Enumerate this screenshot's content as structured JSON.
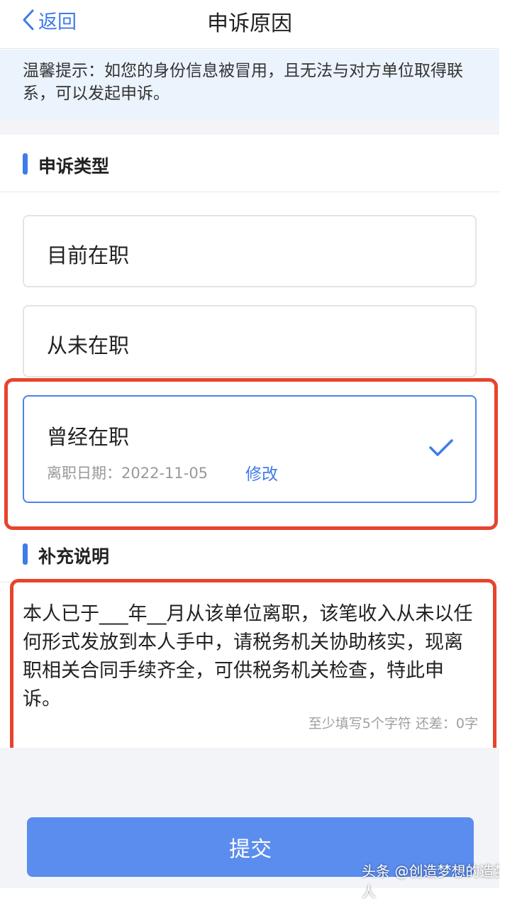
{
  "header": {
    "back_label": "返回",
    "title": "申诉原因"
  },
  "tip": {
    "text": "温馨提示：如您的身份信息被冒用，且无法与对方单位取得联系，可以发起申诉。"
  },
  "appeal_type": {
    "title": "申诉类型",
    "options": [
      {
        "label": "目前在职",
        "selected": false
      },
      {
        "label": "从未在职",
        "selected": false
      },
      {
        "label": "曾经在职",
        "selected": true,
        "date_label": "离职日期：",
        "date_value": "2022-11-05",
        "modify_label": "修改"
      }
    ]
  },
  "supplement": {
    "title": "补充说明",
    "text": "本人已于___年__月从该单位离职，该笔收入从未以任何形式发放到本人手中，请税务机关协助核实，现离职相关合同手续齐全，可供税务机关检查，特此申诉。",
    "counter": "至少填写5个字符 还差：0字"
  },
  "submit_label": "提交",
  "watermark": "头条 @创造梦想的造梦人",
  "colors": {
    "accent": "#3f7be9",
    "submit": "#5b8def",
    "highlight": "#e8432d",
    "tip_bg": "#ebf3fd"
  }
}
